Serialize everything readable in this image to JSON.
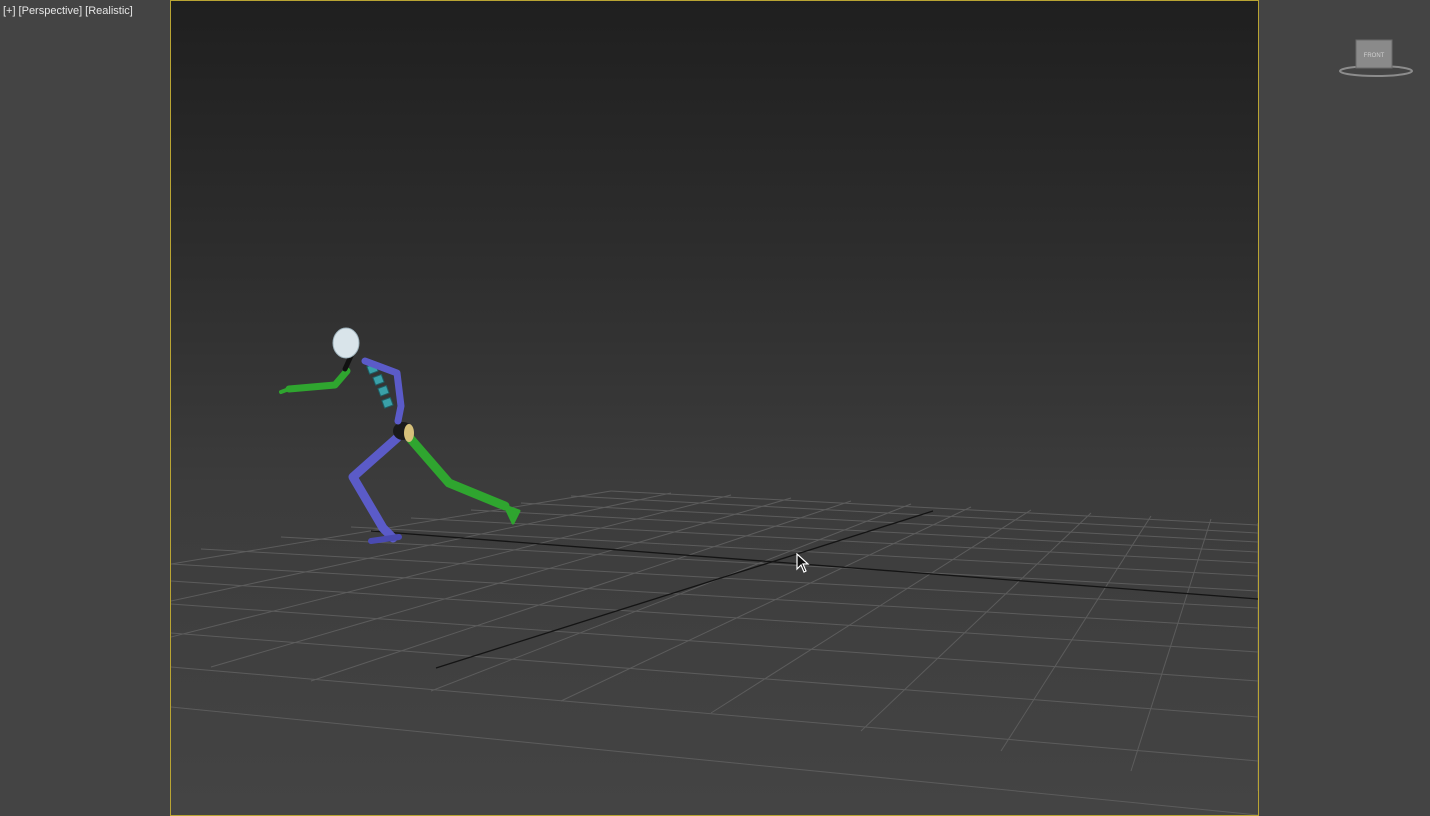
{
  "viewport": {
    "label": {
      "menu": "[+]",
      "view": "[Perspective]",
      "shading": "[Realistic]"
    },
    "active_border_color": "#b9a433"
  },
  "viewcube": {
    "face_label": "FRONT"
  },
  "colors": {
    "background": "#444444",
    "grid": "#5a5a5a",
    "grid_axis": "#111111",
    "biped_blue": "#5b5bc8",
    "biped_green": "#2fa52f",
    "biped_spine": "#3aa0a8",
    "head": "#d9e4ea"
  },
  "icons": {
    "cursor": "arrow-cursor-icon",
    "viewcube": "viewcube-icon"
  }
}
